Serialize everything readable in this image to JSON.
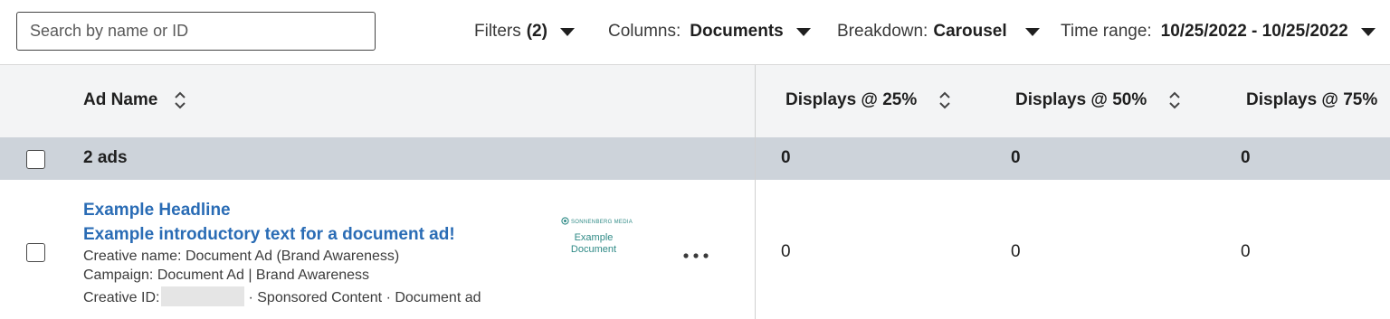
{
  "toolbar": {
    "search_placeholder": "Search by name or ID",
    "filters_label": "Filters",
    "filters_count": "(2)",
    "columns_label": "Columns:",
    "columns_value": "Documents",
    "breakdown_label": "Breakdown:",
    "breakdown_value": "Carousel",
    "time_label": "Time range:",
    "time_value": "10/25/2022 - 10/25/2022"
  },
  "table": {
    "headers": {
      "ad_name": "Ad Name",
      "col1": "Displays @ 25%",
      "col2": "Displays @ 50%",
      "col3": "Displays @ 75%"
    },
    "summary": {
      "label": "2 ads",
      "values": [
        "0",
        "0",
        "0"
      ]
    },
    "row": {
      "headline": "Example Headline",
      "intro": "Example introductory text for a document ad!",
      "creative_name": "Creative name: Document Ad (Brand Awareness)",
      "campaign": "Campaign: Document Ad | Brand Awareness",
      "creative_id_label": "Creative ID:",
      "creative_id_suffix": "· Sponsored Content · Document ad",
      "thumbnail_logo": "SONNENBERG MEDIA",
      "thumbnail_text": "Example Document",
      "values": [
        "0",
        "0",
        "0"
      ]
    }
  },
  "colors": {
    "link": "#2a6cb5",
    "header_bg": "#f3f4f5",
    "summary_bg": "#cdd3da",
    "thumbnail_accent": "#2f8a86"
  },
  "icons": [
    "sort-icon",
    "caret-down-icon",
    "more-options-icon"
  ]
}
